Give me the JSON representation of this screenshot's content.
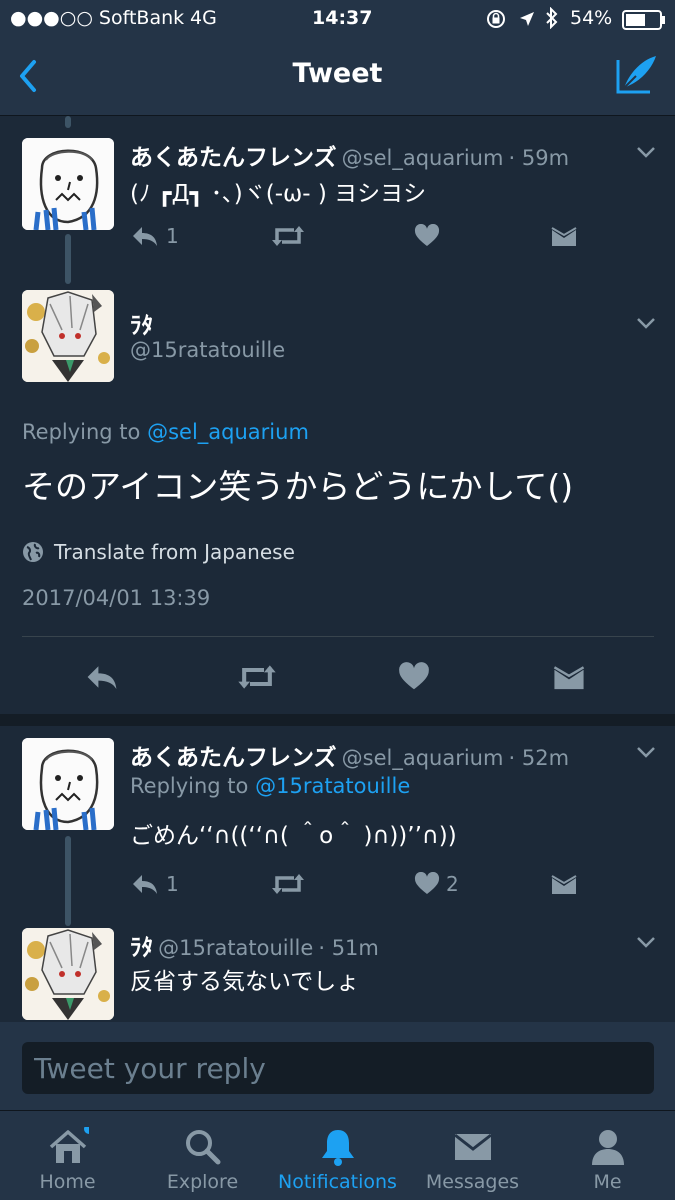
{
  "status_bar": {
    "carrier": "●●●○○ SoftBank",
    "network": "4G",
    "time": "14:37",
    "battery": "54%"
  },
  "nav": {
    "title": "Tweet"
  },
  "tweets": [
    {
      "display_name": "あくあたんフレンズ",
      "handle": "@sel_aquarium",
      "time": "· 59m",
      "text": "(ﾉ ┏Д┓ ･､)ヾ(-ω- ) ヨシヨシ",
      "reply_count": "1",
      "like_count": ""
    },
    {
      "display_name": "ﾗﾀ",
      "handle": "@15ratatouille",
      "replying_prefix": "Replying to",
      "replying_to": "@sel_aquarium",
      "text": "そのアイコン笑うからどうにかして()",
      "translate": "Translate from Japanese",
      "timestamp": "2017/04/01 13:39"
    },
    {
      "display_name": "あくあたんフレンズ",
      "handle": "@sel_aquarium",
      "time": "· 52m",
      "replying_prefix": "Replying to",
      "replying_to": "@15ratatouille",
      "text": "ごめん‘‘∩((‘‘∩( ＾o＾ )∩))’’∩))",
      "reply_count": "1",
      "like_count": "2"
    },
    {
      "display_name": "ﾗﾀ",
      "handle": "@15ratatouille",
      "time": "· 51m",
      "text": "反省する気ないでしょ"
    }
  ],
  "reply_bar": {
    "placeholder": "Tweet your reply"
  },
  "tabs": [
    {
      "label": "Home",
      "icon": "home-icon"
    },
    {
      "label": "Explore",
      "icon": "search-icon"
    },
    {
      "label": "Notifications",
      "icon": "bell-icon"
    },
    {
      "label": "Messages",
      "icon": "envelope-icon"
    },
    {
      "label": "Me",
      "icon": "person-icon"
    }
  ],
  "colors": {
    "accent": "#1da1f2",
    "background": "#1c2938",
    "bar": "#243447",
    "muted": "#8899a6"
  }
}
